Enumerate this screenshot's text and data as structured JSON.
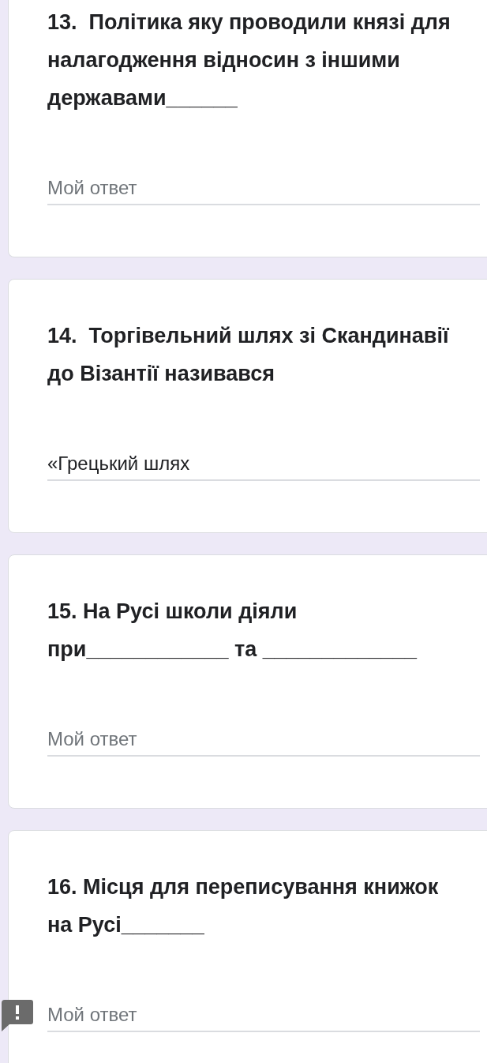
{
  "questions": [
    {
      "title": "13.  Політика яку проводили князі для налагодження відносин з іншими державами______",
      "answer": {
        "placeholder": "Мой ответ"
      }
    },
    {
      "title": "14.  Торгівельний шлях зі Скандинавії до Візантії називався",
      "answer": {
        "value": "«Грецький шлях"
      }
    },
    {
      "title": "15. На Русі школи діяли при____________ та _____________",
      "answer": {
        "placeholder": "Мой ответ"
      }
    },
    {
      "title": "16. Місця для переписування книжок на Русі_______",
      "answer": {
        "placeholder": "Мой ответ"
      }
    }
  ]
}
